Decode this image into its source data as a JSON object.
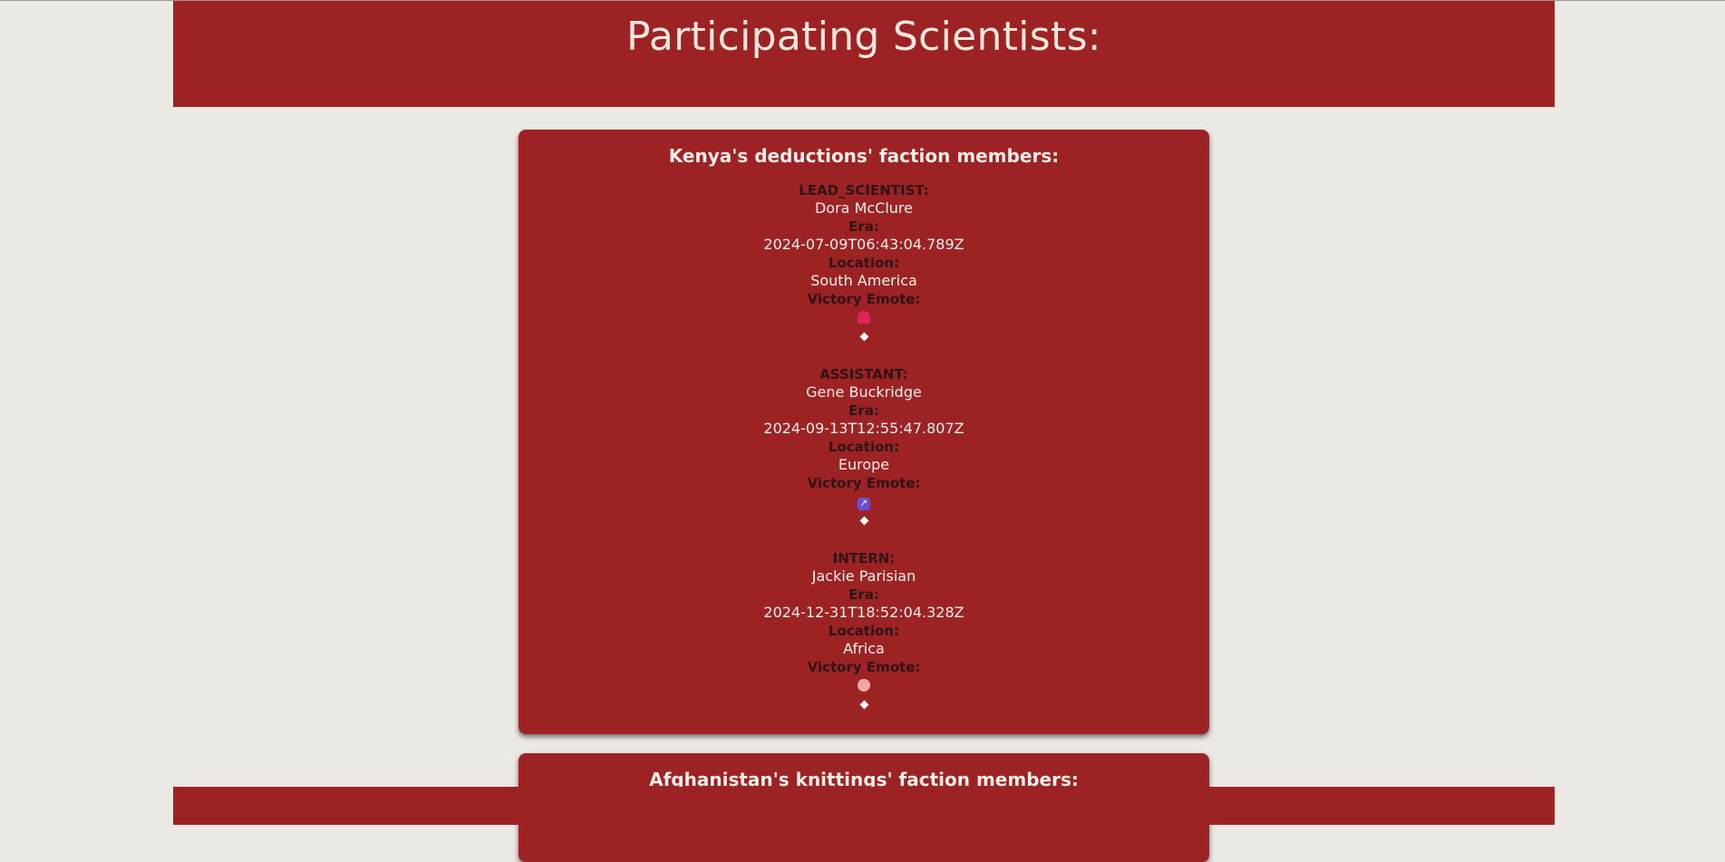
{
  "page": {
    "title": "Participating Scientists:"
  },
  "factions": [
    {
      "title": "Kenya's deductions' faction members:",
      "members": [
        {
          "role_label": "LEAD_SCIENTIST:",
          "name": "Dora McClure",
          "era_label": "Era:",
          "era": "2024-07-09T06:43:04.789Z",
          "location_label": "Location:",
          "location": "South America",
          "emote_label": "Victory Emote:",
          "emote_icon": "pink-blob-emoji",
          "separator": "◆"
        },
        {
          "role_label": "ASSISTANT:",
          "name": "Gene Buckridge",
          "era_label": "Era:",
          "era": "2024-09-13T12:55:47.807Z",
          "location_label": "Location:",
          "location": "Europe",
          "emote_label": "Victory Emote:",
          "emote_icon": "sagittarius-emoji",
          "separator": "◆"
        },
        {
          "role_label": "INTERN:",
          "name": "Jackie Parisian",
          "era_label": "Era:",
          "era": "2024-12-31T18:52:04.328Z",
          "location_label": "Location:",
          "location": "Africa",
          "emote_label": "Victory Emote:",
          "emote_icon": "palette-emoji",
          "separator": "◆"
        }
      ]
    },
    {
      "title": "Afghanistan's knittings' faction members:"
    }
  ],
  "colors": {
    "background": "#ece9e4",
    "panel": "#9d2224",
    "label_text": "#2e1414",
    "value_text": "#f7efe9"
  }
}
